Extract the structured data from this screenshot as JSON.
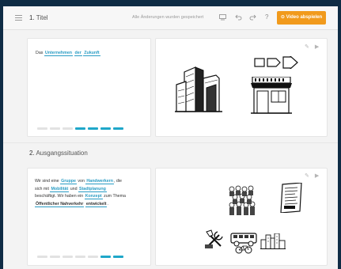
{
  "toolbar": {
    "saved_status": "Alle Änderungen wurden gespeichert",
    "play_label": "Video abspielen",
    "help_label": "?"
  },
  "sections": [
    {
      "number": "1.",
      "title": "Titel",
      "text_plain": [
        "Das "
      ],
      "keywords": [
        "Unternehmen",
        "der",
        "Zukunft"
      ],
      "progress": {
        "total": 7,
        "active_from": 3
      }
    },
    {
      "number": "2.",
      "title": "Ausgangssituation",
      "text": {
        "l1a": "Wir sind eine ",
        "k1": "Gruppe",
        "l1b": " von ",
        "k2": "Handwerkern",
        "l1c": ", die",
        "l2a": "sich mit ",
        "k3": "Mobilität",
        "l2b": " und ",
        "k4": "Stadtplanung",
        "l3a": "beschäftigt. Wir haben ein ",
        "k5": "Konzept",
        "l3b": " zum Thema",
        "k6": "Öffentlicher Nahverkehr",
        "k7": "entwickelt",
        "l4b": "."
      },
      "progress": {
        "total": 7,
        "active_from": 5
      }
    }
  ],
  "colors": {
    "accent": "#1fa7c9",
    "play": "#f19a1c",
    "frame": "#0f2c45"
  }
}
